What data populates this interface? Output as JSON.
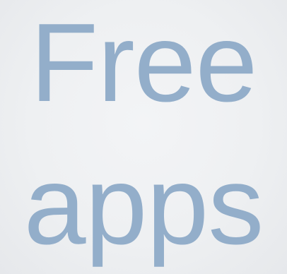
{
  "slide": {
    "line1": "Free",
    "line2": "apps"
  },
  "colors": {
    "text": "#93aeca",
    "background": "#eff1f3"
  }
}
